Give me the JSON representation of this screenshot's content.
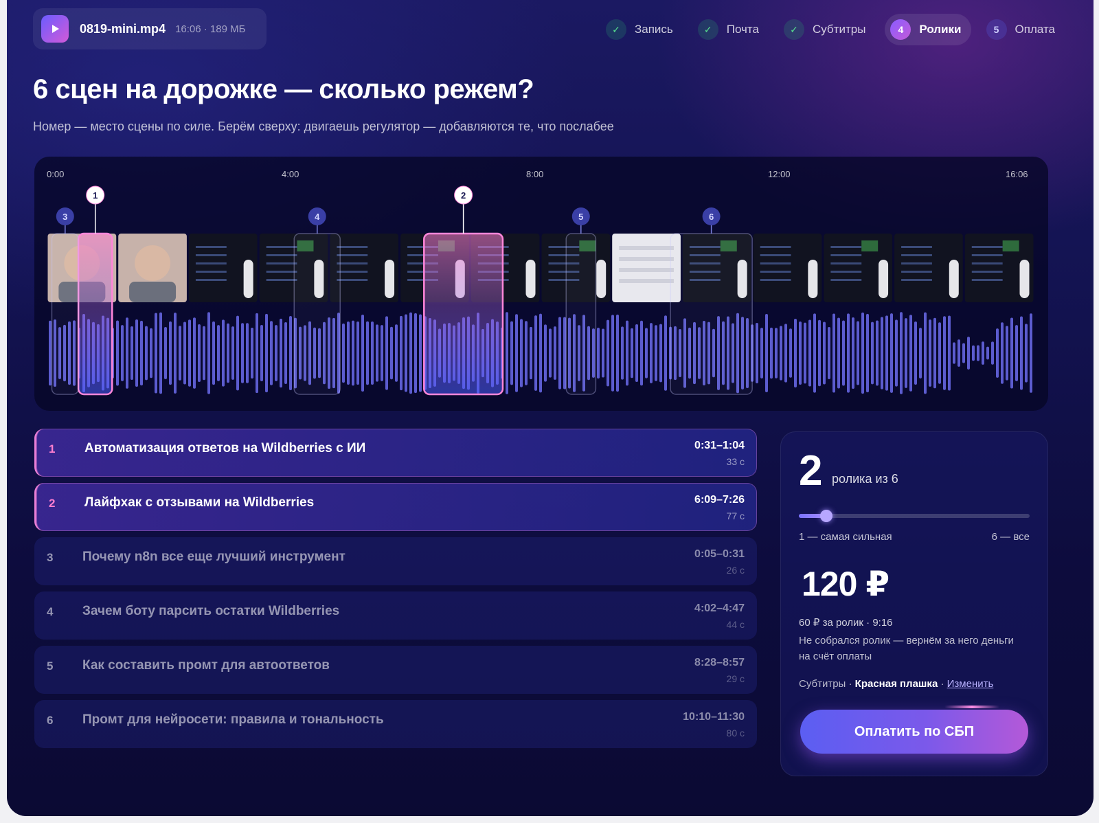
{
  "file": {
    "name": "0819-mini.mp4",
    "meta": "16:06 · 189 МБ",
    "icon": "play-icon"
  },
  "steps": [
    {
      "mark": "✓",
      "label": "Запись",
      "state": "done"
    },
    {
      "mark": "✓",
      "label": "Почта",
      "state": "done"
    },
    {
      "mark": "✓",
      "label": "Субтитры",
      "state": "done"
    },
    {
      "mark": "4",
      "label": "Ролики",
      "state": "active"
    },
    {
      "mark": "5",
      "label": "Оплата",
      "state": "todo"
    }
  ],
  "page": {
    "title": "6 сцен на дорожке — сколько режем?",
    "subtitle": "Номер — место сцены по силе. Берём сверху: двигаешь регулятор — добавляются те, что послабее"
  },
  "timeline": {
    "ticks": [
      "0:00",
      "4:00",
      "8:00",
      "12:00",
      "16:06"
    ],
    "duration_sec": 966,
    "frame_count": 14
  },
  "scenes": [
    {
      "rank": "1",
      "title": "Автоматизация ответов на Wildberries с ИИ",
      "range": "0:31–1:04",
      "duration": "33 с",
      "selected": true
    },
    {
      "rank": "2",
      "title": "Лайфхак с отзывами на Wildberries",
      "range": "6:09–7:26",
      "duration": "77 с",
      "selected": true
    },
    {
      "rank": "3",
      "title": "Почему n8n все еще лучший инструмент",
      "range": "0:05–0:31",
      "duration": "26 с",
      "selected": false
    },
    {
      "rank": "4",
      "title": "Зачем боту парсить остатки Wildberries",
      "range": "4:02–4:47",
      "duration": "44 с",
      "selected": false
    },
    {
      "rank": "5",
      "title": "Как составить промт для автоответов",
      "range": "8:28–8:57",
      "duration": "29 с",
      "selected": false
    },
    {
      "rank": "6",
      "title": "Промт для нейросети: правила и тональность",
      "range": "10:10–11:30",
      "duration": "80 с",
      "selected": false
    }
  ],
  "scene_times": [
    {
      "rank": 1,
      "start": 31,
      "end": 64
    },
    {
      "rank": 2,
      "start": 369,
      "end": 446
    },
    {
      "rank": 3,
      "start": 5,
      "end": 31
    },
    {
      "rank": 4,
      "start": 242,
      "end": 287
    },
    {
      "rank": 5,
      "start": 508,
      "end": 537
    },
    {
      "rank": 6,
      "start": 610,
      "end": 690
    }
  ],
  "order": {
    "count": "2",
    "count_label": "ролика из 6",
    "slider": {
      "value": 2,
      "min": 1,
      "max": 6
    },
    "slider_min_label": "1 — самая сильная",
    "slider_max_label": "6 — все",
    "price": "120 ₽",
    "per_clip": "60 ₽ за ролик · 9:16",
    "refund_note": "Не собрался ролик — вернём за него деньги на счёт оплаты",
    "subs_prefix": "Субтитры · ",
    "subs_style": "Красная плашка",
    "subs_sep": " · ",
    "subs_change": "Изменить",
    "pay_label": "Оплатить по СБП"
  },
  "colors": {
    "accent": "#7b59ea",
    "selected": "#ff7fd0",
    "done": "#57e08f",
    "wave": "#5c5ccf"
  }
}
